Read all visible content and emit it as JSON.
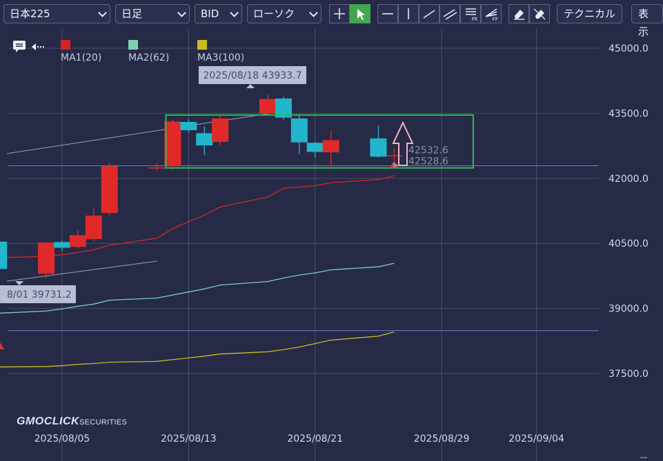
{
  "toolbar": {
    "symbol": "日本225",
    "timeframe": "日足",
    "price_type": "BID",
    "chart_style": "ローソク",
    "technical_label": "テクニカル",
    "display_label": "表示",
    "tool_sub_fr": "FR",
    "tool_sub_ff": "FF"
  },
  "legend": [
    {
      "name": "MA1(20)",
      "color": "#d9221f"
    },
    {
      "name": "MA2(62)",
      "color": "#7fd1b2"
    },
    {
      "name": "MA3(100)",
      "color": "#c9bd22"
    }
  ],
  "watermark": {
    "brand": "GMOCLICK",
    "suffix": "SECURITIES"
  },
  "colors": {
    "up": "#e02a2a",
    "down": "#21b6cc",
    "ma1": "#cf2a24",
    "ma2": "#7fd1b2",
    "ma3": "#c9bd22",
    "box": "#26c04a",
    "arrow": "#f0b6c6",
    "hline": "#5f7bbf"
  },
  "chart_data": {
    "type": "candlestick",
    "y_axis_ticks": [
      "45000.0",
      "43500.0",
      "42000.0",
      "40500.0",
      "39000.0",
      "37500.0"
    ],
    "x_axis_ticks": [
      "2025/08/05",
      "2025/08/13",
      "2025/08/21",
      "2025/08/29",
      "2025/09/04"
    ],
    "ylim": [
      36820,
      45200
    ],
    "candles": [
      {
        "date": "2025/08/01",
        "open": 40540,
        "high": 40960,
        "low": 39731.2,
        "close": 39910
      },
      {
        "date": "2025/08/04",
        "open": 39800,
        "high": 40530,
        "low": 39700,
        "close": 40520
      },
      {
        "date": "2025/08/05",
        "open": 40530,
        "high": 40560,
        "low": 40320,
        "close": 40400
      },
      {
        "date": "2025/08/06",
        "open": 40420,
        "high": 40800,
        "low": 40380,
        "close": 40690
      },
      {
        "date": "2025/08/07",
        "open": 40600,
        "high": 41330,
        "low": 40550,
        "close": 41140
      },
      {
        "date": "2025/08/08",
        "open": 41200,
        "high": 42360,
        "low": 41150,
        "close": 42280
      },
      {
        "date": "2025/08/11",
        "open": 42230,
        "high": 42360,
        "low": 42190,
        "close": 42250
      },
      {
        "date": "2025/08/12",
        "open": 42280,
        "high": 43350,
        "low": 42190,
        "close": 43310
      },
      {
        "date": "2025/08/13",
        "open": 43300,
        "high": 43360,
        "low": 43060,
        "close": 43110
      },
      {
        "date": "2025/08/14",
        "open": 43040,
        "high": 43200,
        "low": 42530,
        "close": 42760
      },
      {
        "date": "2025/08/15",
        "open": 42840,
        "high": 43480,
        "low": 42770,
        "close": 43380
      },
      {
        "date": "2025/08/18",
        "open": 43490,
        "high": 43933.7,
        "low": 43450,
        "close": 43830
      },
      {
        "date": "2025/08/19",
        "open": 43840,
        "high": 43880,
        "low": 43350,
        "close": 43400
      },
      {
        "date": "2025/08/20",
        "open": 43380,
        "high": 43460,
        "low": 42560,
        "close": 42830
      },
      {
        "date": "2025/08/21",
        "open": 42820,
        "high": 42840,
        "low": 42480,
        "close": 42610
      },
      {
        "date": "2025/08/22",
        "open": 42600,
        "high": 43100,
        "low": 42250,
        "close": 42880
      },
      {
        "date": "2025/08/25",
        "open": 42920,
        "high": 43220,
        "low": 42480,
        "close": 42500
      },
      {
        "date": "2025/08/26",
        "open": 42528.6,
        "high": 42700,
        "low": 42300,
        "close": 42532.6
      }
    ],
    "series": [
      {
        "name": "MA1(20)",
        "values": [
          40170,
          40200,
          40240,
          40290,
          40350,
          40460,
          40620,
          40840,
          41000,
          41150,
          41340,
          41570,
          41770,
          41800,
          41830,
          41900,
          41970,
          42060
        ]
      },
      {
        "name": "MA2(62)",
        "values": [
          38890,
          38940,
          38990,
          39050,
          39100,
          39190,
          39240,
          39310,
          39380,
          39450,
          39540,
          39620,
          39700,
          39770,
          39820,
          39890,
          39960,
          40040
        ]
      },
      {
        "name": "MA3(100)",
        "values": [
          37650,
          37660,
          37680,
          37710,
          37730,
          37760,
          37780,
          37820,
          37860,
          37900,
          37950,
          38000,
          38050,
          38110,
          38190,
          38270,
          38360,
          38460
        ]
      }
    ],
    "trendlines": [
      {
        "from": {
          "date": "2025/07/30",
          "price": 42570
        },
        "to": {
          "date": "2025/08/18",
          "price": 43490
        }
      },
      {
        "from": {
          "date": "2025/07/30",
          "price": 39630
        },
        "to": {
          "date": "2025/08/11",
          "price": 40090
        }
      }
    ],
    "horizontal_lines": [
      {
        "price": 42290,
        "color": "#5f7bbf"
      },
      {
        "price": 38490,
        "color": "#5f7bbf"
      }
    ],
    "annotations": {
      "high_label": "2025/08/18 43933.7",
      "low_label": "8/01 39731.2",
      "price_ask_label": "42532.6",
      "price_bid_label": "42528.6",
      "box": {
        "from_date": "2025/08/12",
        "to_date": "2025/08/31",
        "price_high": 43460,
        "price_low": 42240
      }
    }
  }
}
